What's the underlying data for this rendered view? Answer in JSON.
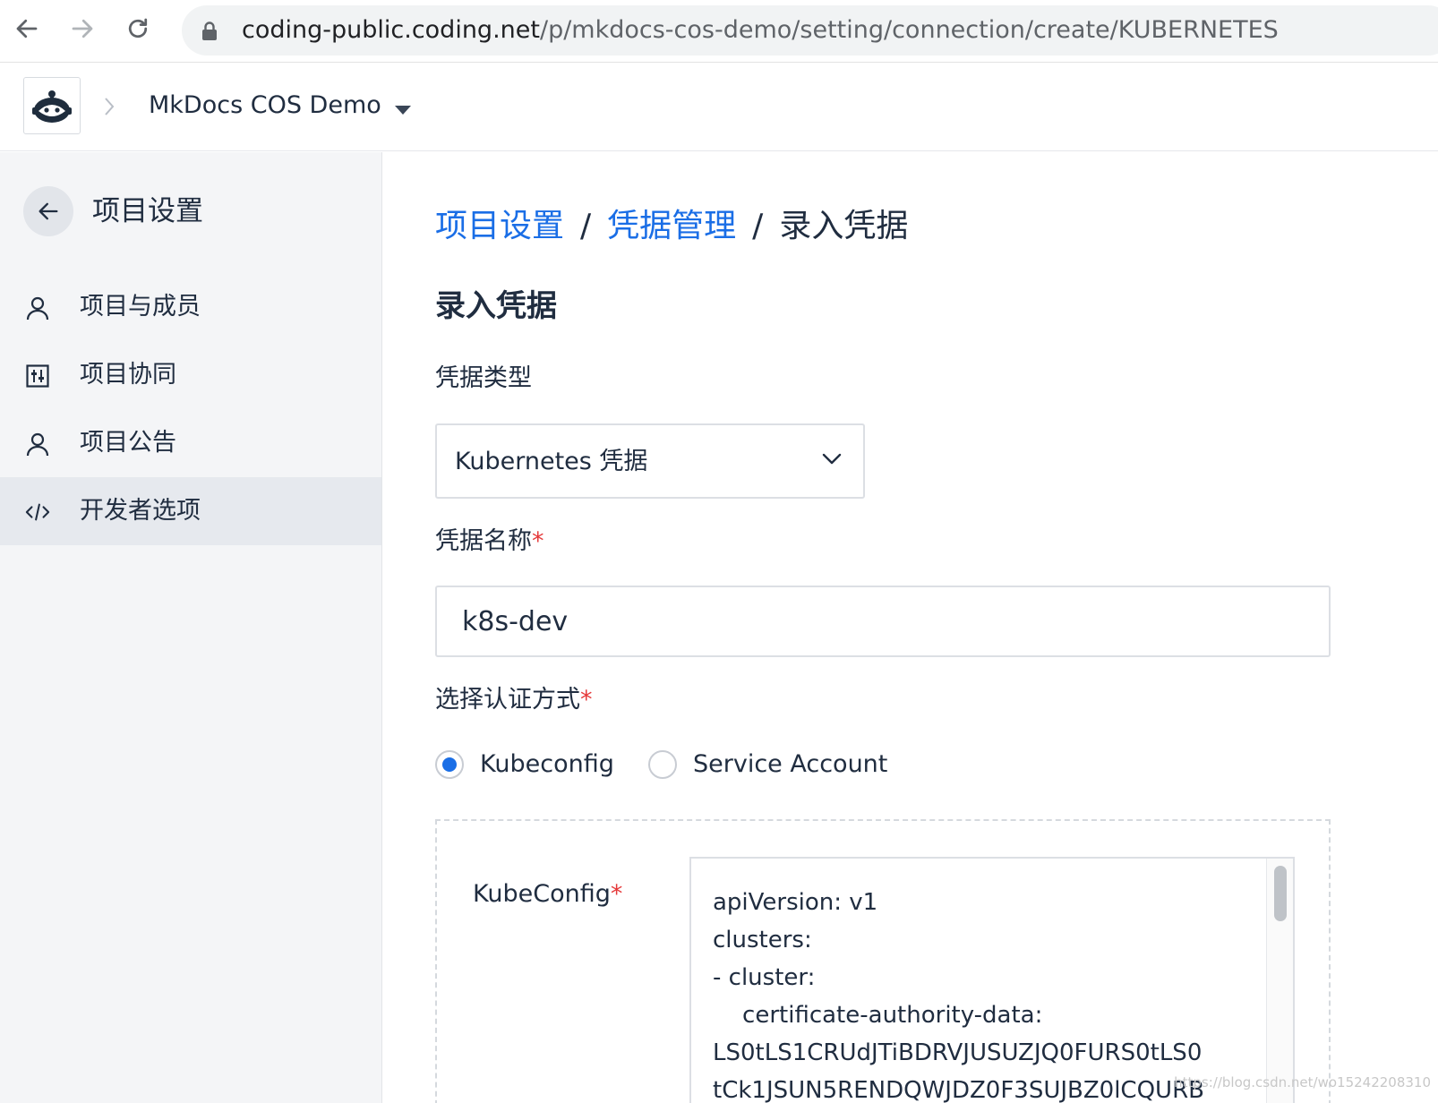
{
  "browser": {
    "url_host": "coding-public.coding.net",
    "url_path": "/p/mkdocs-cos-demo/setting/connection/create/KUBERNETES"
  },
  "header": {
    "project_name": "MkDocs COS Demo"
  },
  "sidebar": {
    "title": "项目设置",
    "items": [
      {
        "label": "项目与成员",
        "icon": "user-icon"
      },
      {
        "label": "项目协同",
        "icon": "sliders-icon"
      },
      {
        "label": "项目公告",
        "icon": "user-icon"
      },
      {
        "label": "开发者选项",
        "icon": "code-icon",
        "active": true
      }
    ]
  },
  "main": {
    "breadcrumb": [
      "项目设置",
      "凭据管理",
      "录入凭据"
    ],
    "breadcrumb_sep": "/",
    "title": "录入凭据",
    "credential_type_label": "凭据类型",
    "credential_type_value": "Kubernetes 凭据",
    "credential_name_label": "凭据名称",
    "credential_name_value": "k8s-dev",
    "auth_method_label": "选择认证方式",
    "auth_options": [
      "Kubeconfig",
      "Service Account"
    ],
    "auth_selected": "Kubeconfig",
    "kubeconfig_label": "KubeConfig",
    "required_mark": "*",
    "kubeconfig_value": "apiVersion: v1\nclusters:\n- cluster:\n    certificate-authority-data:\nLS0tLS1CRUdJTiBDRVJUSUZJQ0FURS0tLS0\ntCk1JSUN5RENDQWJDZ0F3SUJBZ0lCQURB"
  },
  "watermark": "https://blog.csdn.net/wo15242208310",
  "colors": {
    "accent": "#1a6ee6",
    "required": "#e5393a",
    "sidebar_bg": "#f4f5f7"
  }
}
